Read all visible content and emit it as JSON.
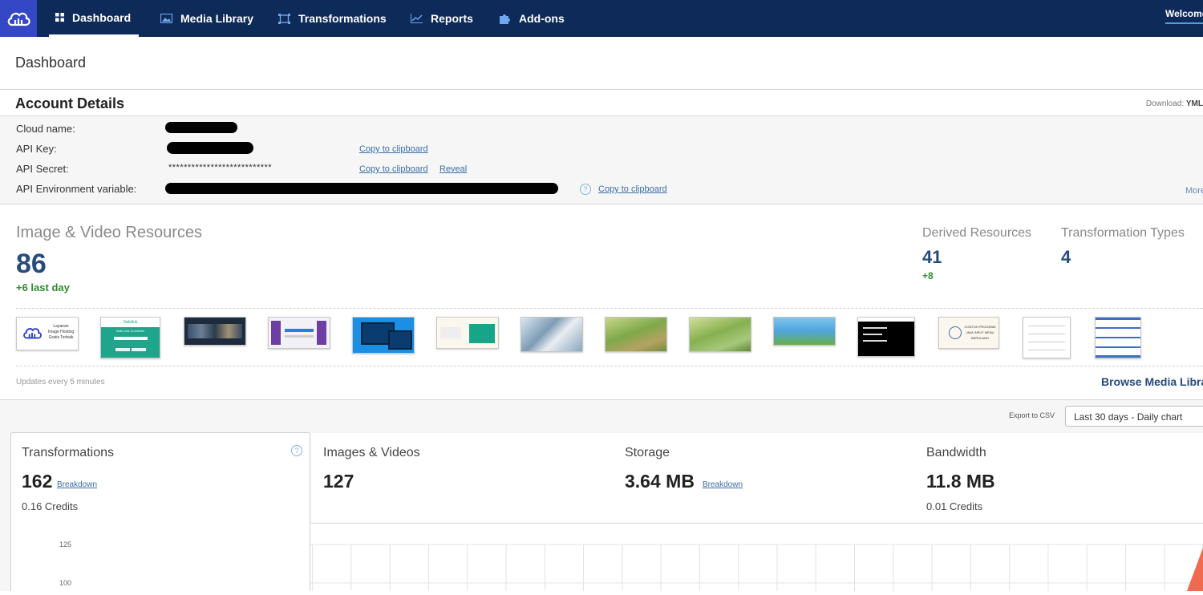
{
  "nav": {
    "items": [
      {
        "label": "Dashboard",
        "icon": "grid-icon"
      },
      {
        "label": "Media Library",
        "icon": "image-icon"
      },
      {
        "label": "Transformations",
        "icon": "transform-icon"
      },
      {
        "label": "Reports",
        "icon": "line-chart-icon"
      },
      {
        "label": "Add-ons",
        "icon": "puzzle-icon"
      }
    ],
    "welcome": "Welcome"
  },
  "page_title": "Dashboard",
  "account": {
    "title": "Account Details",
    "download_label": "Download:",
    "download_format": "YML",
    "labels": {
      "cloud_name": "Cloud name:",
      "api_key": "API Key:",
      "api_secret": "API Secret:",
      "api_env": "API Environment variable:"
    },
    "secret_masked": "***************************",
    "copy": "Copy to clipboard",
    "reveal": "Reveal",
    "more": "More"
  },
  "resources": {
    "title": "Image & Video Resources",
    "count": "86",
    "delta": "+6 last day",
    "derived_title": "Derived Resources",
    "derived_count": "41",
    "derived_delta": "+8",
    "types_title": "Transformation Types",
    "types_count": "4",
    "updates": "Updates every 5 minutes",
    "browse": "Browse Media Library"
  },
  "thumbs": {
    "t1": [
      "Layanan",
      "Image Hosting",
      "Gratis Terbaik"
    ],
    "t2_title": "Safelink",
    "t2_sub": "Safe Link Converter",
    "t12": [
      "CONTOH PROGRAM",
      "JAVA INPUT MENU",
      "BERULANG"
    ]
  },
  "usage": {
    "export": "Export to CSV",
    "range": "Last 30 days - Daily chart",
    "cards": [
      {
        "title": "Transformations",
        "value": "162",
        "link": "Breakdown",
        "credits": "0.16 Credits"
      },
      {
        "title": "Images & Videos",
        "value": "127"
      },
      {
        "title": "Storage",
        "value": "3.64 MB",
        "link": "Breakdown"
      },
      {
        "title": "Bandwidth",
        "value": "11.8 MB",
        "credits": "0.01 Credits"
      }
    ]
  },
  "chart_data": {
    "type": "area",
    "y_ticks": [
      "125",
      "100"
    ],
    "grid": true
  },
  "colors": {
    "topbar": "#0e2a58",
    "logo_bg": "#3448c5",
    "accent_blue": "#274b7c",
    "positive": "#2e8b2e"
  }
}
